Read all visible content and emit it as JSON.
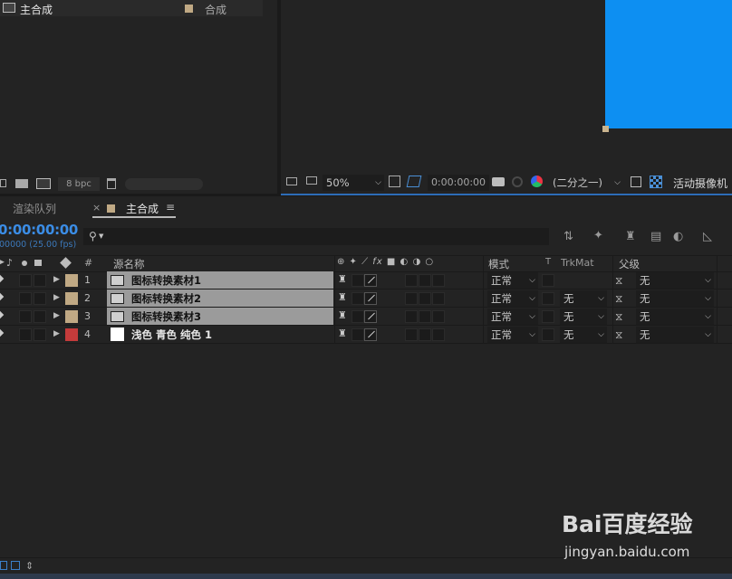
{
  "project": {
    "item_name": "主合成",
    "item_type": "合成",
    "bit_depth": "8 bpc",
    "swatch_color": "#c0a984"
  },
  "viewer": {
    "zoom": "50%",
    "timecode": "0:00:00:00",
    "resolution": "(二分之一)",
    "camera": "活动摄像机",
    "solid_color": "#0d8ff2"
  },
  "tabs": {
    "render_queue": "渲染队列",
    "close": "×",
    "comp": "主合成",
    "menu": "≡"
  },
  "timeline": {
    "timecode": "0:00:00:00",
    "fps": "00000 (25.00 fps)",
    "search_placeholder": "",
    "headers": {
      "number": "#",
      "source_name": "源名称",
      "mode": "模式",
      "t": "T",
      "trkmat": "TrkMat",
      "parent": "父级"
    },
    "layers": [
      {
        "num": "1",
        "name": "图标转换素材1",
        "label_color": "#c0a984",
        "mode": "正常",
        "trkmat": "",
        "parent": "无",
        "selected": true
      },
      {
        "num": "2",
        "name": "图标转换素材2",
        "label_color": "#c0a984",
        "mode": "正常",
        "trkmat": "无",
        "parent": "无",
        "selected": true
      },
      {
        "num": "3",
        "name": "图标转换素材3",
        "label_color": "#c0a984",
        "mode": "正常",
        "trkmat": "无",
        "parent": "无",
        "selected": true
      },
      {
        "num": "4",
        "name": "浅色 青色 纯色 1",
        "label_color": "#c43b3b",
        "mode": "正常",
        "trkmat": "无",
        "parent": "无",
        "selected": false
      }
    ]
  },
  "watermark": {
    "brand": "Bai百度经验",
    "url": "jingyan.baidu.com"
  },
  "colors": {
    "accent": "#2d8ceb",
    "selection_row": "#9b9b9b"
  }
}
